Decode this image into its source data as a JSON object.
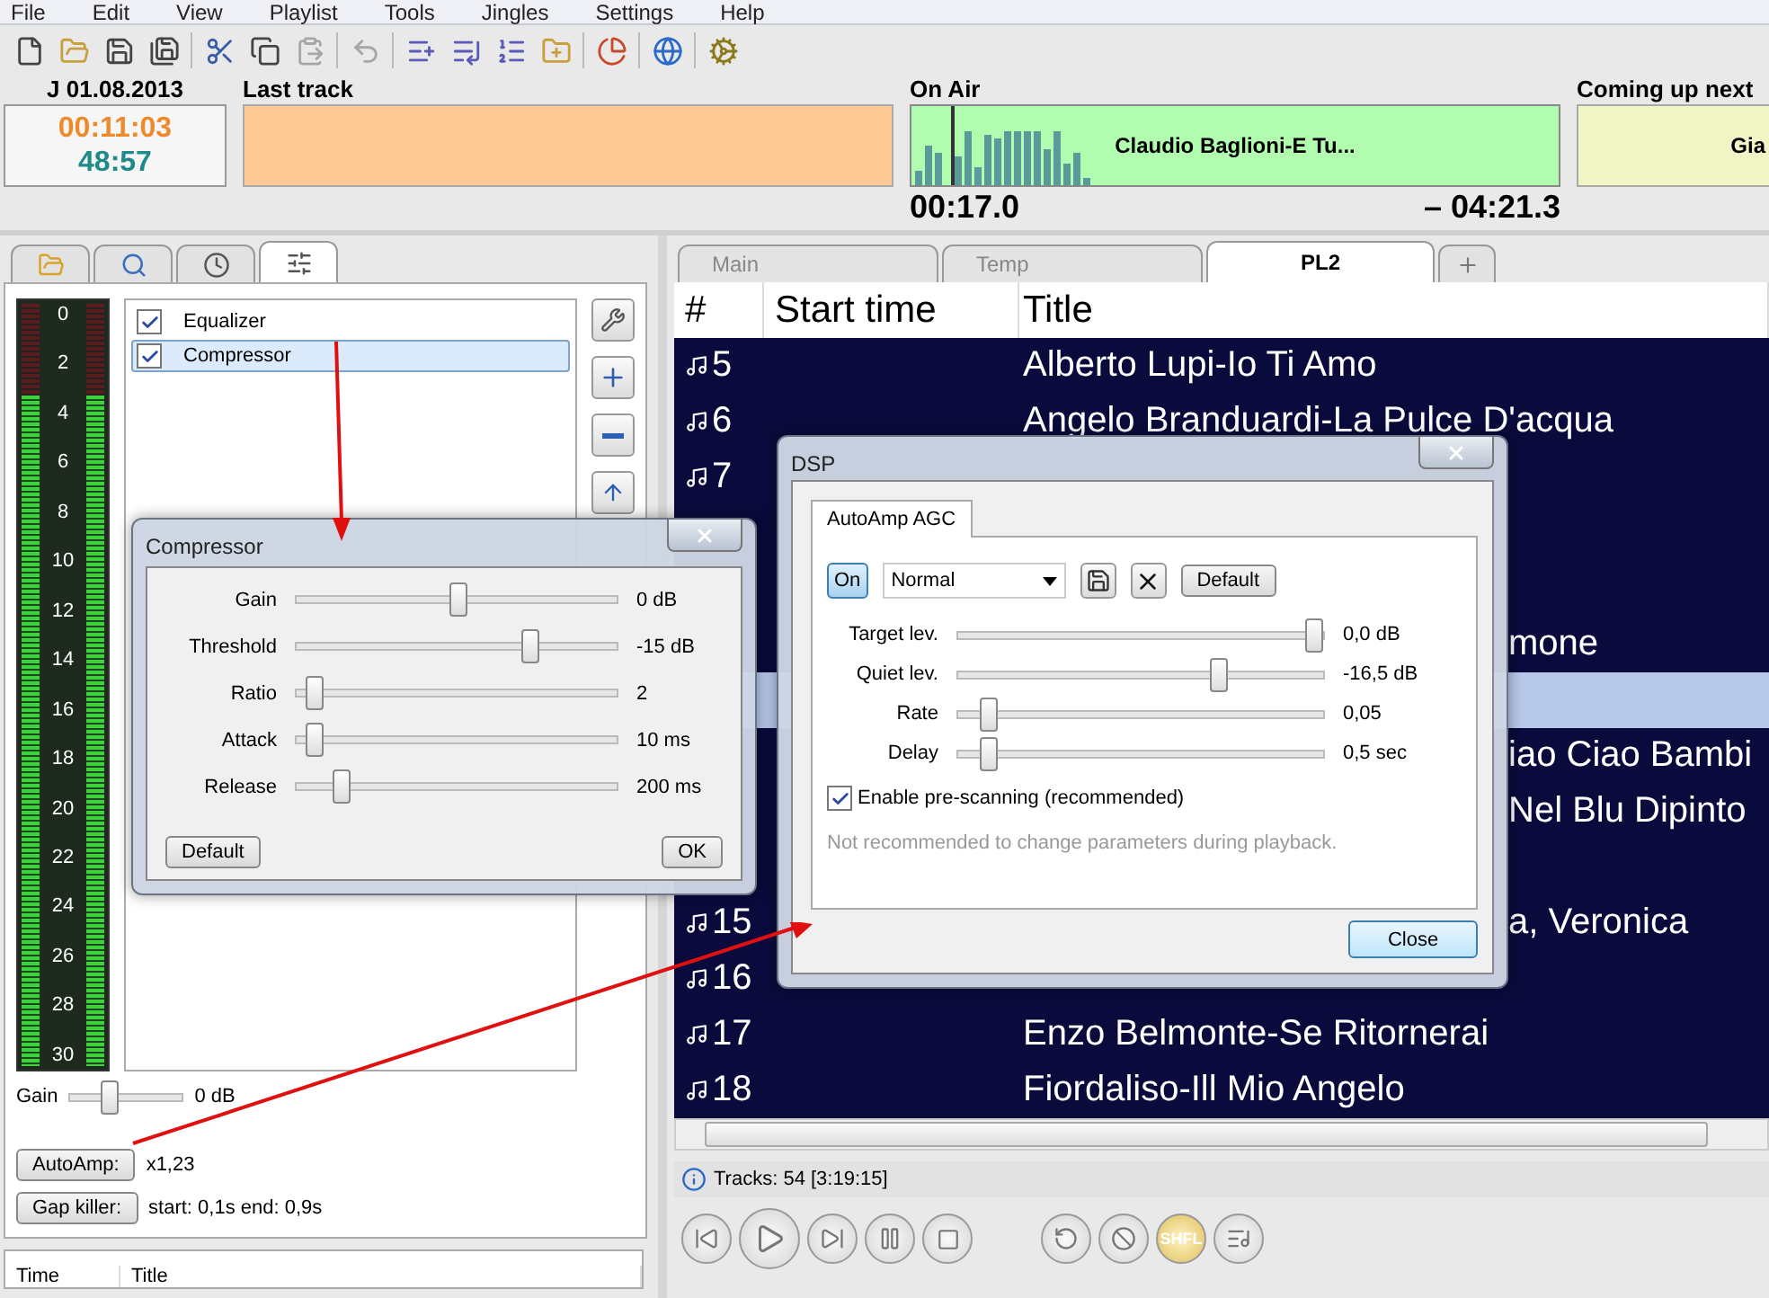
{
  "menu": [
    "File",
    "Edit",
    "View",
    "Playlist",
    "Tools",
    "Jingles",
    "Settings",
    "Help"
  ],
  "clock": {
    "date": "J 01.08.2013",
    "time": "00:11:03",
    "remaining": "48:57"
  },
  "last_track": {
    "label": "Last track"
  },
  "on_air": {
    "label": "On Air",
    "title": "Claudio Baglioni-E Tu...",
    "elapsed": "00:17.0",
    "remaining": "– 04:21.3",
    "level": 0.06
  },
  "coming_up_next": {
    "label": "Coming up next",
    "title": "Gia"
  },
  "left_tabs": [
    {
      "selected": false
    },
    {
      "selected": false
    },
    {
      "selected": false
    },
    {
      "selected": true
    }
  ],
  "vu_meter": {
    "scale": [
      "0",
      "2",
      "4",
      "6",
      "8",
      "10",
      "12",
      "14",
      "16",
      "18",
      "20",
      "22",
      "24",
      "26",
      "28",
      "30"
    ],
    "channels": [
      {
        "level": 0.88
      },
      {
        "level": 0.88
      }
    ]
  },
  "effects": [
    {
      "label": "Equalizer",
      "checked": true,
      "selected": false
    },
    {
      "label": "Compressor",
      "checked": true,
      "selected": true
    }
  ],
  "gain": {
    "label": "Gain",
    "level": 0.3,
    "reading": "0 dB"
  },
  "autoamp": {
    "button": "AutoAmp:",
    "value": "x1,23"
  },
  "gap_killer": {
    "button": "Gap killer:",
    "value": "start: 0,1s end: 0,9s"
  },
  "history_columns": [
    "Time",
    "Title"
  ],
  "playlist_tabs": [
    {
      "label": "Main",
      "selected": false
    },
    {
      "label": "Temp",
      "selected": false
    },
    {
      "label": "PL2",
      "selected": true
    }
  ],
  "playlist": {
    "columns": [
      "#",
      "Start time",
      "Title"
    ],
    "rows": [
      {
        "number": "5",
        "title": "Alberto Lupi-Io Ti Amo",
        "selected": false
      },
      {
        "number": "6",
        "title": "Angelo Branduardi-La Pulce D'acqua",
        "selected": false
      },
      {
        "number": "7",
        "selected": false
      },
      {
        "selected": false
      },
      {
        "selected": false
      },
      {
        "title_tail": "mone",
        "selected": false
      },
      {
        "selected": true
      },
      {
        "title_tail": "iao Ciao Bambi",
        "selected": false
      },
      {
        "title_tail": "Nel Blu Dipinto",
        "selected": false
      },
      {
        "selected": false
      },
      {
        "number": "15",
        "title_tail": "a, Veronica",
        "selected": false
      },
      {
        "number": "16",
        "selected": false
      },
      {
        "number": "17",
        "title": "Enzo Belmonte-Se Ritornerai",
        "selected": false
      },
      {
        "number": "18",
        "title": "Fiordaliso-Ill Mio Angelo",
        "selected": false
      }
    ]
  },
  "status": "Tracks: 54 [3:19:15]",
  "shuffle": {
    "label": "SHFL",
    "on": true
  },
  "compressor": {
    "title": "Compressor",
    "sliders": [
      {
        "label": "Gain",
        "level": 0.5,
        "reading": "0 dB"
      },
      {
        "label": "Threshold",
        "level": 0.74,
        "reading": "-15 dB"
      },
      {
        "label": "Ratio",
        "level": 0.02,
        "reading": "2"
      },
      {
        "label": "Attack",
        "level": 0.02,
        "reading": "10 ms"
      },
      {
        "label": "Release",
        "level": 0.11,
        "reading": "200 ms"
      }
    ],
    "default_button": "Default",
    "ok_button": "OK"
  },
  "dsp": {
    "title": "DSP",
    "tab": "AutoAmp AGC",
    "toggle": {
      "label": "On",
      "on": true
    },
    "preset": "Normal",
    "default_button": "Default",
    "sliders": [
      {
        "label": "Target lev.",
        "level": 1.0,
        "reading": "0,0 dB"
      },
      {
        "label": "Quiet lev.",
        "level": 0.72,
        "reading": "-16,5 dB"
      },
      {
        "label": "Rate",
        "level": 0.05,
        "reading": "0,05"
      },
      {
        "label": "Delay",
        "level": 0.05,
        "reading": "0,5 sec"
      }
    ],
    "prescan": {
      "label": "Enable pre-scanning (recommended)",
      "checked": true
    },
    "note": "Not recommended to change parameters during playback.",
    "close_button": "Close"
  }
}
